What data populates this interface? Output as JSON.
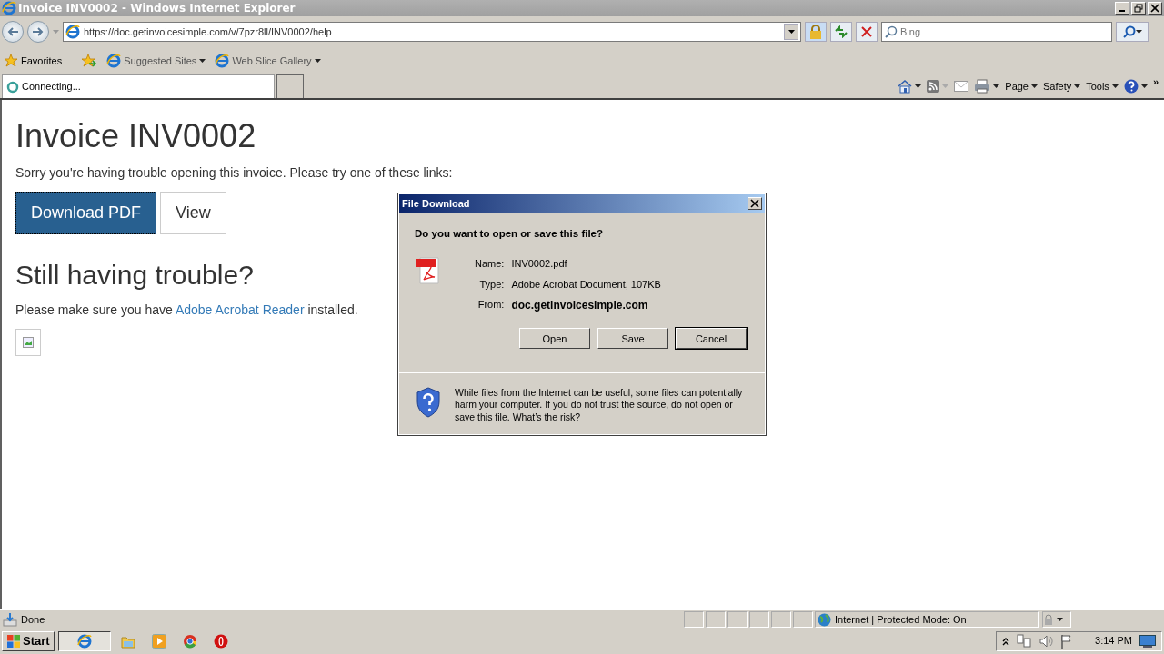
{
  "window": {
    "title": "Invoice INV0002 - Windows Internet Explorer"
  },
  "address_bar": {
    "url": "https://doc.getinvoicesimple.com/v/7pzr8ll/INV0002/help"
  },
  "search": {
    "placeholder": "Bing"
  },
  "favorites_bar": {
    "favorites": "Favorites",
    "links": [
      "Suggested Sites",
      "Web Slice Gallery"
    ]
  },
  "tab": {
    "label": "Connecting...",
    "selected": true
  },
  "command_bar": {
    "menus": [
      "Page",
      "Safety",
      "Tools"
    ],
    "more": "»"
  },
  "page": {
    "heading": "Invoice INV0002",
    "intro": "Sorry you're having trouble opening this invoice. Please try one of these links:",
    "buttons": [
      {
        "label": "Download PDF",
        "kind": "primary"
      },
      {
        "label": "View",
        "kind": "default"
      }
    ],
    "subheading": "Still having trouble?",
    "help_before": "Please make sure you have",
    "help_link": "Adobe Acrobat Reader",
    "help_after": "installed."
  },
  "dialog": {
    "title": "File Download",
    "question": "Do you want to open or save this file?",
    "fields": [
      {
        "label": "Name:",
        "value": "INV0002.pdf",
        "bold": false
      },
      {
        "label": "Type:",
        "value": "Adobe Acrobat Document, 107KB",
        "bold": false
      },
      {
        "label": "From:",
        "value": "doc.getinvoicesimple.com",
        "bold": true
      }
    ],
    "buttons": [
      {
        "label": "Open",
        "default": false
      },
      {
        "label": "Save",
        "default": false
      },
      {
        "label": "Cancel",
        "default": true
      }
    ],
    "warning": "While files from the Internet can be useful, some files can potentially harm your computer. If you do not trust the source, do not open or save this file.",
    "risk_link": "What’s the risk?"
  },
  "status_bar": {
    "text": "Done",
    "zone": "Internet | Protected Mode: On"
  },
  "taskbar": {
    "start": "Start",
    "clock": "3:14 PM"
  }
}
